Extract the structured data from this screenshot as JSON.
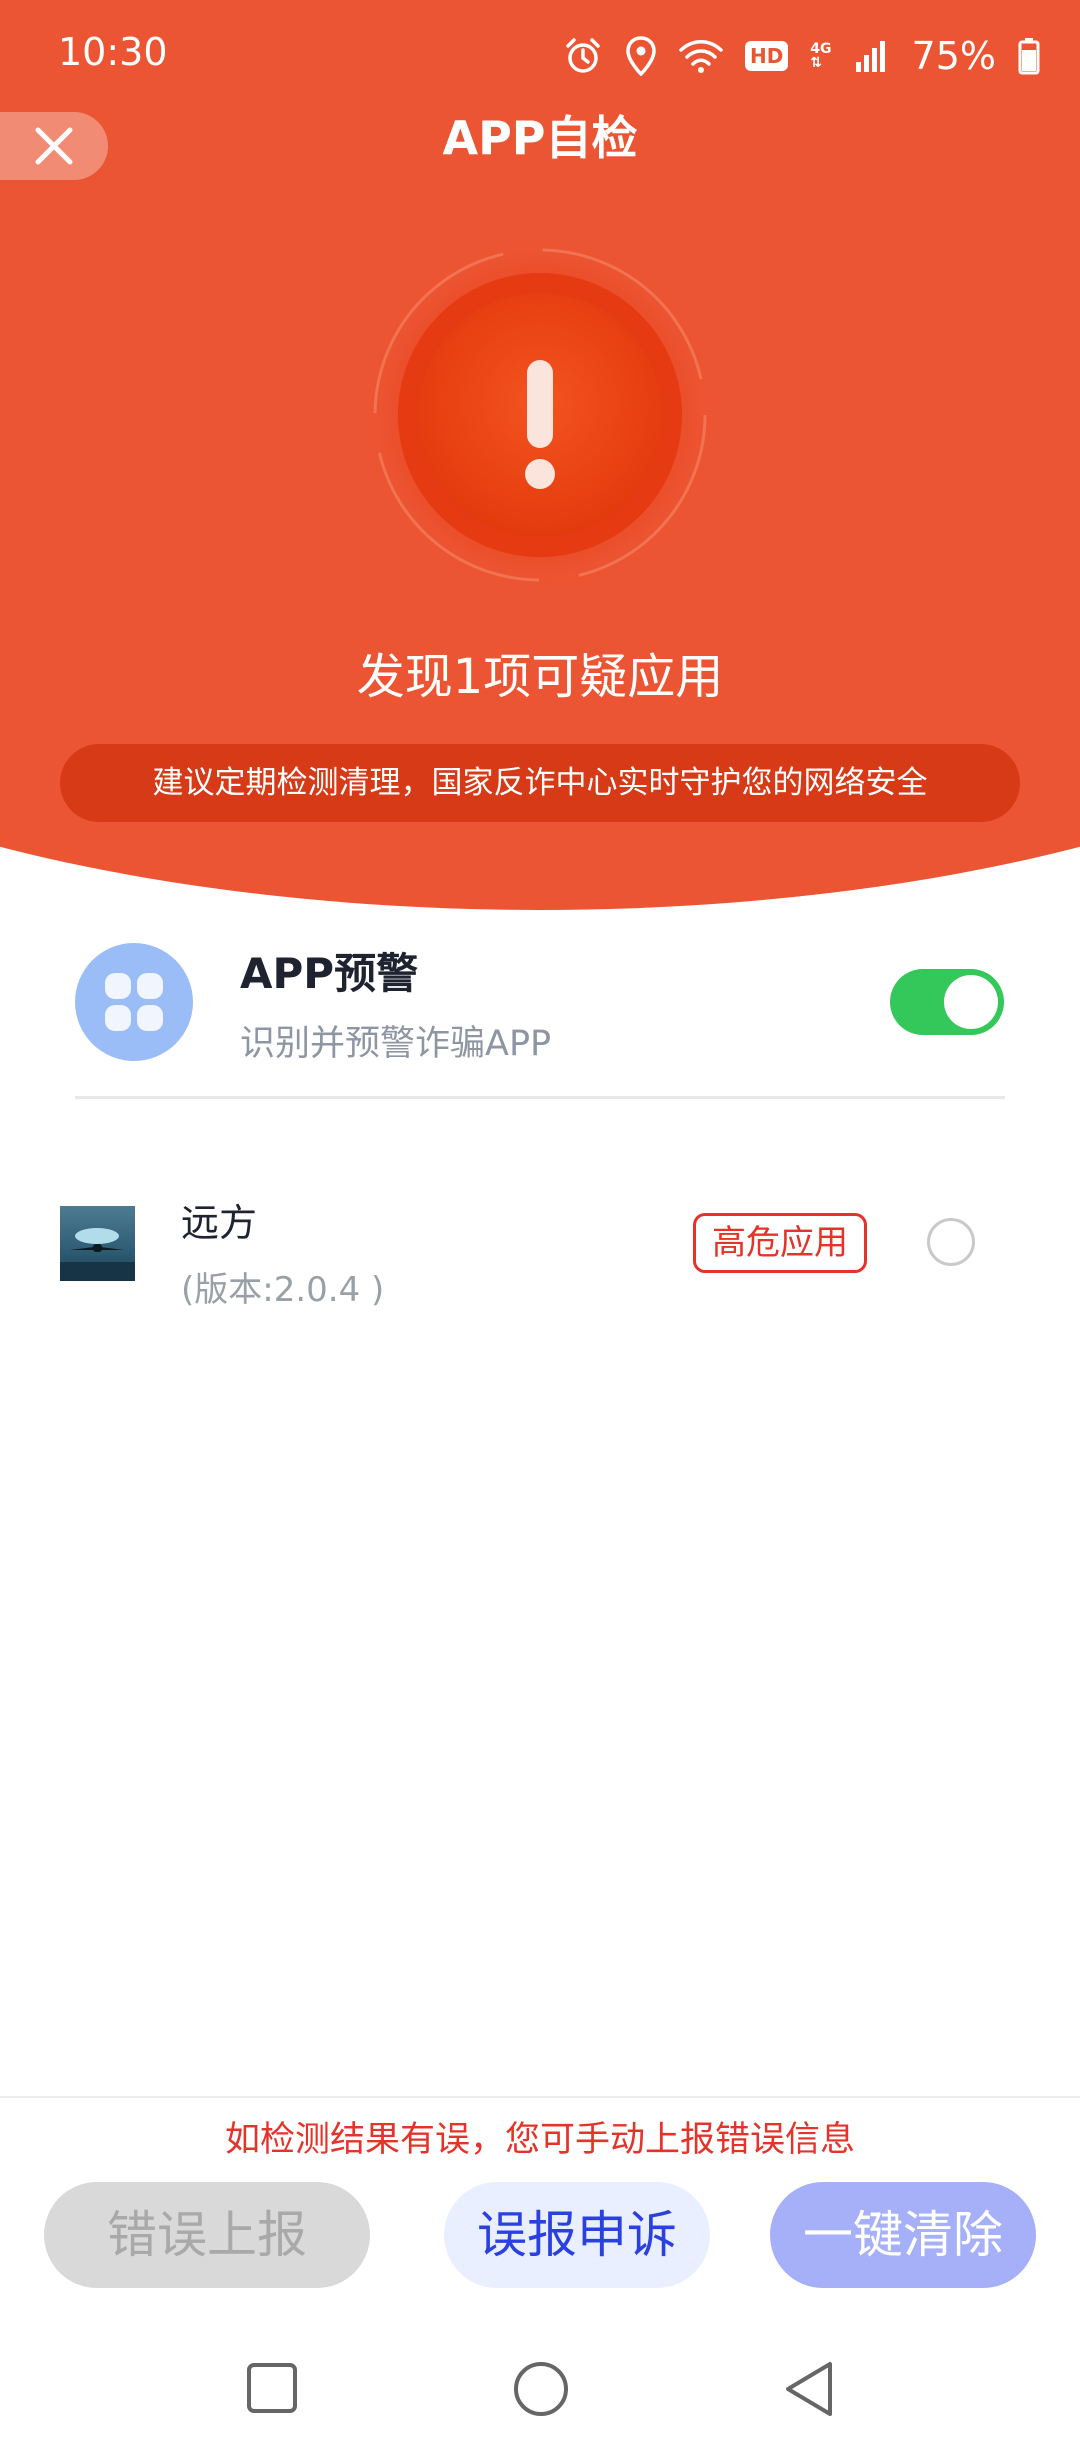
{
  "status_bar": {
    "time": "10:30",
    "hd": "HD",
    "net_top": "4G",
    "net_bottom": "⇅",
    "battery": "75%"
  },
  "header": {
    "title": "APP自检",
    "close_icon": "close-icon",
    "result": "发现1项可疑应用",
    "tip": "建议定期检测清理，国家反诈中心实时守护您的网络安全"
  },
  "feature": {
    "title": "APP预警",
    "subtitle": "识别并预警诈骗APP",
    "toggle_on": true,
    "icon": "app-grid-icon"
  },
  "apps": [
    {
      "name": "远方",
      "version": "(版本:2.0.4 )",
      "risk": "高危应用",
      "selected": false
    }
  ],
  "bottom": {
    "hint": "如检测结果有误，您可手动上报错误信息",
    "report_label": "错误上报",
    "appeal_label": "误报申诉",
    "clear_label": "一键清除"
  },
  "colors": {
    "header_red": "#ec5533",
    "tip_red": "#d63a17",
    "risk_red": "#e6332a",
    "toggle_green": "#34c759",
    "appeal_blue": "#2a41e0",
    "clear_blue": "#a5b0f8"
  }
}
